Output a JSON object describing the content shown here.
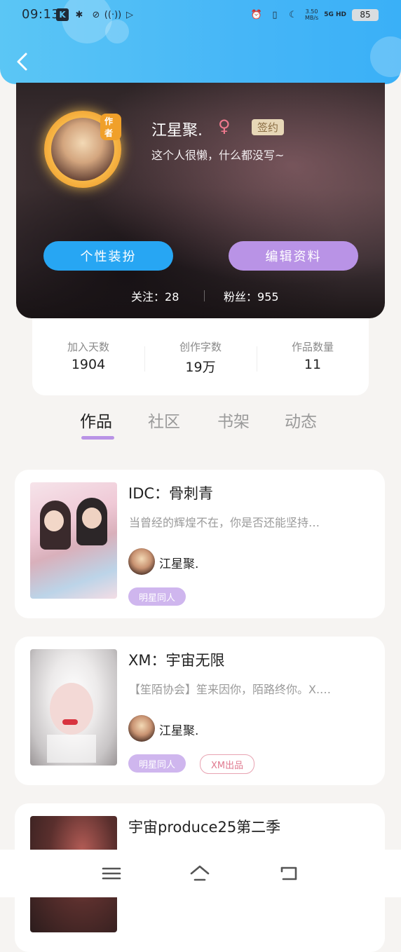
{
  "status_bar": {
    "time": "09:13",
    "net_speed_value": "3.50",
    "net_speed_unit": "MB/s",
    "network": "5G HD",
    "battery": "85"
  },
  "icons": {
    "back": "back-arrow-icon",
    "menu": "menu-icon",
    "home": "home-icon",
    "return": "return-icon"
  },
  "profile": {
    "name": "江星聚.",
    "gender_symbol": "♀",
    "signed_badge": "签约",
    "writer_badge": "作者",
    "bio": "这个人很懒，什么都没写~",
    "dress_button": "个性装扮",
    "edit_button": "编辑资料",
    "following_label": "关注：",
    "following_count": "28",
    "fans_label": "粉丝：",
    "fans_count": "955"
  },
  "stats": [
    {
      "label": "加入天数",
      "value": "1904"
    },
    {
      "label": "创作字数",
      "value": "19万"
    },
    {
      "label": "作品数量",
      "value": "11"
    }
  ],
  "tabs": [
    {
      "label": "作品",
      "active": true
    },
    {
      "label": "社区",
      "active": false
    },
    {
      "label": "书架",
      "active": false
    },
    {
      "label": "动态",
      "active": false
    }
  ],
  "works": [
    {
      "title": "IDC：骨刺青",
      "description": "当曾经的辉煌不在，你是否还能坚持…",
      "author": "江星聚.",
      "tags": [
        "明星同人"
      ]
    },
    {
      "title": "XM：宇宙无限",
      "description": "【笙陌协会】笙来因你，陌路终你。X.…",
      "author": "江星聚.",
      "tags": [
        "明星同人",
        "XM出品"
      ]
    },
    {
      "title": "宇宙produce25第二季",
      "description": "",
      "author": "",
      "tags": []
    }
  ],
  "colors": {
    "header_blue": "#46b6f7",
    "accent_purple": "#b993e6",
    "button_blue": "#27a6f3"
  }
}
